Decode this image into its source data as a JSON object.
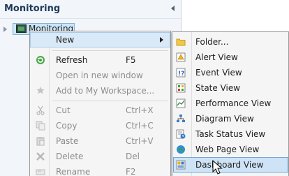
{
  "nav": {
    "title": "Monitoring",
    "tree_node": "Monitoring"
  },
  "context_menu": {
    "items": [
      {
        "label": "New",
        "shortcut": "",
        "icon": "none",
        "disabled": false,
        "submenu": true
      },
      {
        "label": "Refresh",
        "shortcut": "F5",
        "icon": "refresh-icon",
        "disabled": false
      },
      {
        "label": "Open in new window",
        "shortcut": "",
        "icon": "none",
        "disabled": true
      },
      {
        "label": "Add to My Workspace...",
        "shortcut": "",
        "icon": "add-favorite-icon",
        "disabled": true
      },
      {
        "label": "Cut",
        "shortcut": "Ctrl+X",
        "icon": "scissors-icon",
        "disabled": true
      },
      {
        "label": "Copy",
        "shortcut": "Ctrl+C",
        "icon": "copy-icon",
        "disabled": true
      },
      {
        "label": "Paste",
        "shortcut": "Ctrl+V",
        "icon": "paste-icon",
        "disabled": true
      },
      {
        "label": "Delete",
        "shortcut": "Del",
        "icon": "delete-icon",
        "disabled": true
      },
      {
        "label": "Rename",
        "shortcut": "F2",
        "icon": "rename-icon",
        "disabled": true
      }
    ]
  },
  "new_submenu": {
    "items": [
      {
        "label": "Folder...",
        "icon": "folder-icon"
      },
      {
        "label": "Alert View",
        "icon": "alert-view-icon"
      },
      {
        "label": "Event View",
        "icon": "event-view-icon"
      },
      {
        "label": "State View",
        "icon": "state-view-icon"
      },
      {
        "label": "Performance View",
        "icon": "performance-view-icon"
      },
      {
        "label": "Diagram View",
        "icon": "diagram-view-icon"
      },
      {
        "label": "Task Status View",
        "icon": "task-status-view-icon"
      },
      {
        "label": "Web Page View",
        "icon": "web-page-view-icon"
      },
      {
        "label": "Dashboard View",
        "icon": "dashboard-view-icon"
      }
    ],
    "highlighted": "Dashboard View"
  },
  "colors": {
    "nav_background": "#f2f5f9",
    "menu_background": "#f5f5f5",
    "highlight": "#cfe3f6",
    "disabled_text": "#8d8d8d"
  }
}
